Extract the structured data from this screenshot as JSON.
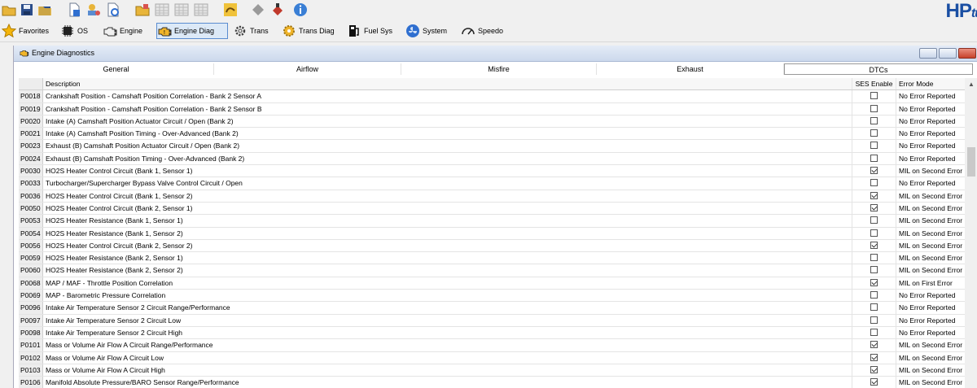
{
  "app": {
    "logo_main": "HP",
    "logo_sub": "tu"
  },
  "toolbar_icons": [
    "open-folder-icon",
    "save-icon",
    "save-as-icon",
    "file-info-icon",
    "vehicle-info-icon",
    "compare-icon",
    "read-icon",
    "table-grid-icon",
    "table-grid-icon",
    "table-grid-icon",
    "tune-icon",
    "diamond-icon",
    "flash-icon",
    "info-icon"
  ],
  "nav": [
    {
      "label": "Favorites",
      "icon": "star-icon"
    },
    {
      "label": "OS",
      "icon": "chip-icon"
    },
    {
      "label": "Engine",
      "icon": "engine-icon"
    },
    {
      "label": "Engine Diag",
      "icon": "engine-diag-icon",
      "selected": true
    },
    {
      "label": "Trans",
      "icon": "gear-icon"
    },
    {
      "label": "Trans Diag",
      "icon": "trans-diag-icon"
    },
    {
      "label": "Fuel Sys",
      "icon": "fuel-pump-icon"
    },
    {
      "label": "System",
      "icon": "fan-icon"
    },
    {
      "label": "Speedo",
      "icon": "speedometer-icon"
    }
  ],
  "window": {
    "title": "Engine Diagnostics"
  },
  "tabs": [
    "General",
    "Airflow",
    "Misfire",
    "Exhaust",
    "DTCs"
  ],
  "table": {
    "columns": [
      "",
      "Description",
      "SES Enable",
      "Error Mode"
    ],
    "rows": [
      {
        "code": "P0018",
        "desc": "Crankshaft Position - Camshaft Position Correlation - Bank 2 Sensor A",
        "ses": false,
        "mode": "No Error Reported"
      },
      {
        "code": "P0019",
        "desc": "Crankshaft Position - Camshaft Position Correlation - Bank 2 Sensor B",
        "ses": false,
        "mode": "No Error Reported"
      },
      {
        "code": "P0020",
        "desc": "Intake (A) Camshaft Position Actuator Circuit / Open (Bank 2)",
        "ses": false,
        "mode": "No Error Reported"
      },
      {
        "code": "P0021",
        "desc": "Intake (A) Camshaft Position Timing - Over-Advanced (Bank 2)",
        "ses": false,
        "mode": "No Error Reported"
      },
      {
        "code": "P0023",
        "desc": "Exhaust (B) Camshaft Position Actuator Circuit / Open (Bank 2)",
        "ses": false,
        "mode": "No Error Reported"
      },
      {
        "code": "P0024",
        "desc": "Exhaust (B) Camshaft Position Timing - Over-Advanced (Bank 2)",
        "ses": false,
        "mode": "No Error Reported"
      },
      {
        "code": "P0030",
        "desc": "HO2S Heater Control Circuit (Bank 1, Sensor 1)",
        "ses": true,
        "mode": "MIL on Second Error"
      },
      {
        "code": "P0033",
        "desc": "Turbocharger/Supercharger Bypass Valve Control Circuit / Open",
        "ses": false,
        "mode": "No Error Reported"
      },
      {
        "code": "P0036",
        "desc": "HO2S Heater Control Circuit (Bank 1, Sensor 2)",
        "ses": true,
        "mode": "MIL on Second Error"
      },
      {
        "code": "P0050",
        "desc": "HO2S Heater Control Circuit (Bank 2, Sensor 1)",
        "ses": true,
        "mode": "MIL on Second Error"
      },
      {
        "code": "P0053",
        "desc": "HO2S Heater Resistance (Bank 1, Sensor 1)",
        "ses": false,
        "mode": "MIL on Second Error"
      },
      {
        "code": "P0054",
        "desc": "HO2S Heater Resistance (Bank 1, Sensor 2)",
        "ses": false,
        "mode": "MIL on Second Error"
      },
      {
        "code": "P0056",
        "desc": "HO2S Heater Control Circuit (Bank 2, Sensor 2)",
        "ses": true,
        "mode": "MIL on Second Error"
      },
      {
        "code": "P0059",
        "desc": "HO2S Heater Resistance (Bank 2, Sensor 1)",
        "ses": false,
        "mode": "MIL on Second Error"
      },
      {
        "code": "P0060",
        "desc": "HO2S Heater Resistance (Bank 2, Sensor 2)",
        "ses": false,
        "mode": "MIL on Second Error"
      },
      {
        "code": "P0068",
        "desc": "MAP / MAF - Throttle Position Correlation",
        "ses": true,
        "mode": "MIL on First Error"
      },
      {
        "code": "P0069",
        "desc": "MAP - Barometric Pressure Correlation",
        "ses": false,
        "mode": "No Error Reported"
      },
      {
        "code": "P0096",
        "desc": "Intake Air Temperature Sensor 2 Circuit Range/Performance",
        "ses": false,
        "mode": "No Error Reported"
      },
      {
        "code": "P0097",
        "desc": "Intake Air Temperature Sensor 2 Circuit Low",
        "ses": false,
        "mode": "No Error Reported"
      },
      {
        "code": "P0098",
        "desc": "Intake Air Temperature Sensor 2 Circuit High",
        "ses": false,
        "mode": "No Error Reported"
      },
      {
        "code": "P0101",
        "desc": "Mass or Volume Air Flow A Circuit Range/Performance",
        "ses": true,
        "mode": "MIL on Second Error"
      },
      {
        "code": "P0102",
        "desc": "Mass or Volume Air Flow A Circuit Low",
        "ses": true,
        "mode": "MIL on Second Error"
      },
      {
        "code": "P0103",
        "desc": "Mass or Volume Air Flow A Circuit High",
        "ses": true,
        "mode": "MIL on Second Error"
      },
      {
        "code": "P0106",
        "desc": "Manifold Absolute Pressure/BARO Sensor Range/Performance",
        "ses": true,
        "mode": "MIL on Second Error"
      }
    ]
  }
}
